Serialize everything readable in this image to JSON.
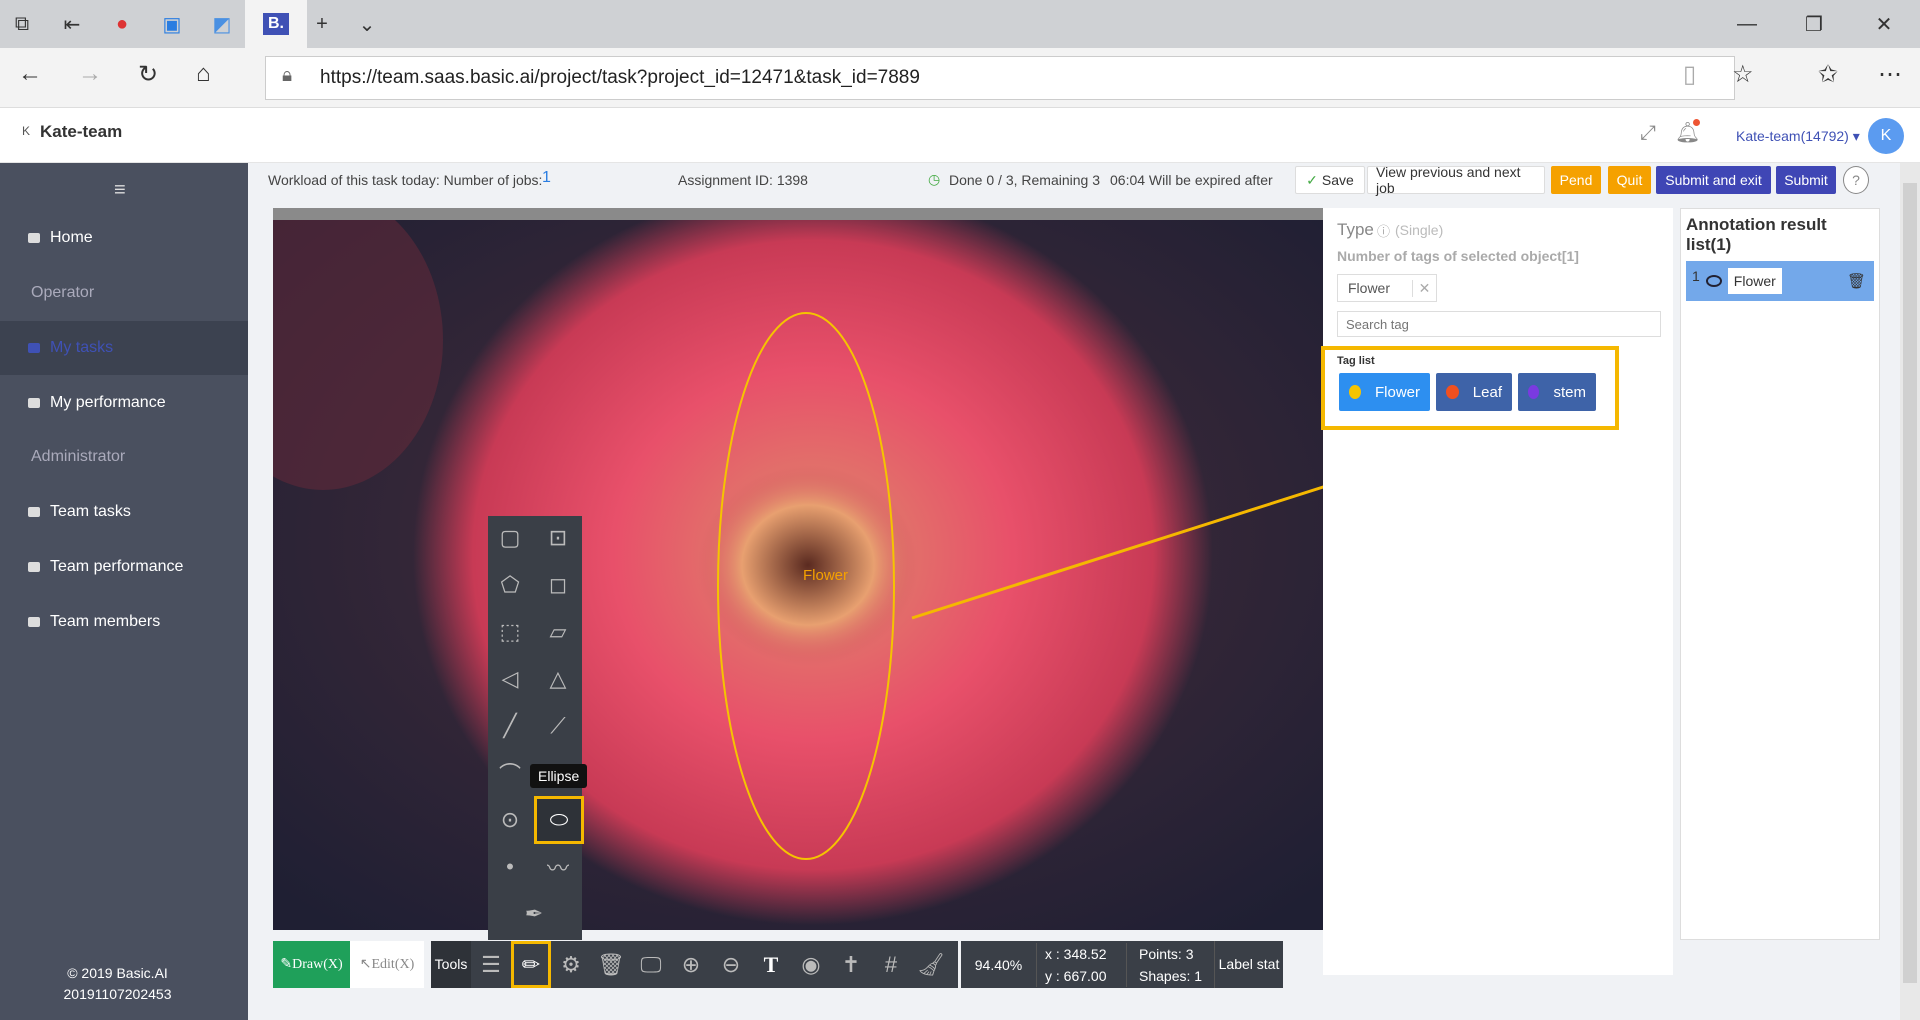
{
  "browser": {
    "url": "https://team.saas.basic.ai/project/task?project_id=12471&task_id=7889",
    "active_tab_label": "B."
  },
  "header": {
    "team": "Kate-team",
    "logo": "K",
    "user": "Kate-team(14792)",
    "avatar": "K"
  },
  "sidebar": {
    "items": [
      {
        "label": "Home"
      },
      {
        "label": "Operator"
      },
      {
        "label": "My tasks"
      },
      {
        "label": "My performance"
      },
      {
        "label": "Administrator"
      },
      {
        "label": "Team tasks"
      },
      {
        "label": "Team performance"
      },
      {
        "label": "Team members"
      }
    ],
    "copyright": "© 2019 Basic.AI",
    "build": "20191107202453"
  },
  "info": {
    "workload_label": "Workload of this task today: Number of jobs:",
    "jobs": "1",
    "assignment": "Assignment ID: 1398",
    "progress": "Done 0 / 3, Remaining 3",
    "expire": "06:04 Will be expired after"
  },
  "actions": {
    "save": "Save",
    "view": "View previous and next job",
    "pend": "Pend",
    "quit": "Quit",
    "submit_exit": "Submit and exit",
    "submit": "Submit",
    "help": "?"
  },
  "type_panel": {
    "type": "Type",
    "single": "(Single)",
    "count_label": "Number of tags of selected object[1]",
    "selected_tag": "Flower",
    "search_placeholder": "Search tag",
    "tag_list_label": "Tag list",
    "tags": [
      {
        "label": "Flower",
        "color": "#f5c400"
      },
      {
        "label": "Leaf",
        "color": "#f05020"
      },
      {
        "label": "stem",
        "color": "#7a3ae0"
      }
    ]
  },
  "results": {
    "title": "Annotation result list(1)",
    "items": [
      {
        "index": "1",
        "label": "Flower"
      }
    ]
  },
  "canvas": {
    "annotation_label": "Flower",
    "tooltip": "Ellipse"
  },
  "toolbar": {
    "draw": "Draw(X)",
    "edit": "Edit(X)",
    "tools": "Tools",
    "zoom": "94.40%",
    "x": "x : 348.52",
    "y": "y : 667.00",
    "points": "Points:  3",
    "shapes": "Shapes:  1",
    "label_stat": "Label stat"
  }
}
